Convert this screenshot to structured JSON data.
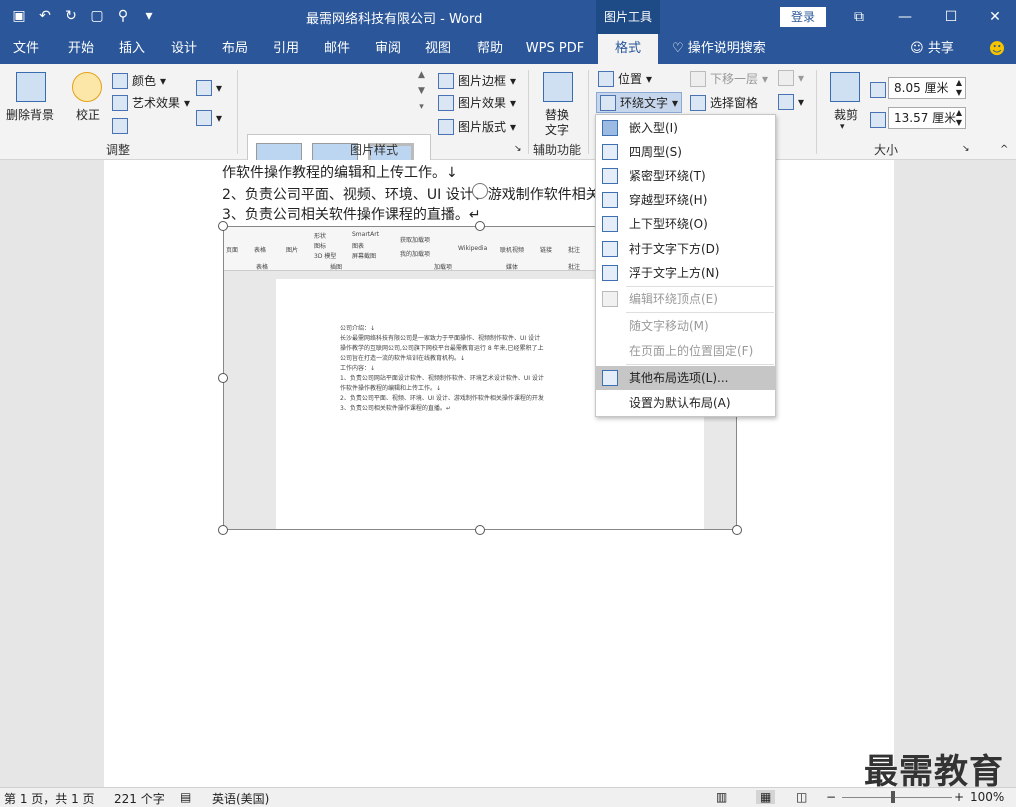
{
  "window": {
    "title": "最需网络科技有限公司  -  Word",
    "context_tab_group": "图片工具",
    "login_label": "登录",
    "qat_icons": [
      "save-icon",
      "undo-icon",
      "redo-icon",
      "new-doc-icon",
      "touch-icon",
      "customize-icon"
    ]
  },
  "tabs": [
    "文件",
    "开始",
    "插入",
    "设计",
    "布局",
    "引用",
    "邮件",
    "审阅",
    "视图",
    "帮助",
    "WPS PDF",
    "格式"
  ],
  "active_tab": "格式",
  "tell_me": "操作说明搜索",
  "share": "共享",
  "ribbon": {
    "adjust": {
      "remove_bg": "删除背景",
      "correct": "校正",
      "color": "颜色",
      "art_effect": "艺术效果",
      "group_label": "调整"
    },
    "picture_styles": {
      "border": "图片边框",
      "effect": "图片效果",
      "layout": "图片版式",
      "group_label": "图片样式"
    },
    "accessibility": {
      "alt_text_line1": "替换",
      "alt_text_line2": "文字",
      "group_label": "辅助功能"
    },
    "arrange": {
      "position": "位置",
      "wrap_text": "环绕文字",
      "send_backward": "下移一层",
      "selection_pane": "选择窗格"
    },
    "size": {
      "crop": "裁剪",
      "height": "8.05 厘米",
      "width": "13.57 厘米",
      "group_label": "大小"
    }
  },
  "document": {
    "line1": "作软件操作教程的编辑和上传工作。↓",
    "line2": "2、负责公司平面、视频、环境、UI 设计、游戏制作软件相关",
    "line3": "3、负责公司相关软件操作课程的直播。↵"
  },
  "picture": {
    "ribbon_labels": [
      "页面",
      "表格",
      "图片",
      "形状",
      "图标",
      "3D 模型",
      "SmartArt",
      "图表",
      "屏幕截图",
      "获取加载项",
      "我的加载项",
      "Wikipedia",
      "联机视频",
      "链接",
      "批注"
    ],
    "group_labels": [
      "表格",
      "插图",
      "加载项",
      "媒体",
      "批注"
    ],
    "lines": [
      "公司介绍：↓",
      "长沙最需网络科技有限公司是一家致力于平面操作、视频制作软件、UI 设计",
      "操作教学的互联网公司,公司旗下网校平台最需教育运行 8 年来,已经累积了上",
      "公司旨在打造一流的软件培训在线教育机构。↓",
      "工作内容：↓",
      "1、负责公司网站平面设计软件、视频制作软件、环境艺术设计软件、UI 设计",
      "作软件操作教程的编辑和上传工作。↓",
      "2、负责公司平面、视频、环境、UI 设计、游戏制作软件相关操作课程的开发",
      "3、负责公司相关软件操作课程的直播。↵"
    ]
  },
  "wrap_menu": {
    "items": [
      {
        "label": "嵌入型(I)",
        "icon": "inline-wrap-icon",
        "disabled": false
      },
      {
        "label": "四周型(S)",
        "icon": "square-wrap-icon",
        "disabled": false
      },
      {
        "label": "紧密型环绕(T)",
        "icon": "tight-wrap-icon",
        "disabled": false
      },
      {
        "label": "穿越型环绕(H)",
        "icon": "through-wrap-icon",
        "disabled": false
      },
      {
        "label": "上下型环绕(O)",
        "icon": "top-bottom-wrap-icon",
        "disabled": false
      },
      {
        "label": "衬于文字下方(D)",
        "icon": "behind-text-icon",
        "disabled": false
      },
      {
        "label": "浮于文字上方(N)",
        "icon": "in-front-text-icon",
        "disabled": false
      },
      {
        "label": "编辑环绕顶点(E)",
        "icon": "edit-wrap-points-icon",
        "disabled": true
      },
      {
        "label": "随文字移动(M)",
        "icon": "",
        "disabled": true
      },
      {
        "label": "在页面上的位置固定(F)",
        "icon": "",
        "disabled": true
      },
      {
        "label": "其他布局选项(L)...",
        "icon": "more-layout-icon",
        "disabled": false
      },
      {
        "label": "设置为默认布局(A)",
        "icon": "",
        "disabled": false
      }
    ],
    "highlighted": "其他布局选项(L)..."
  },
  "status": {
    "page": "第 1 页，共 1 页",
    "words": "221 个字",
    "language": "英语(美国)",
    "zoom": "100%"
  },
  "watermark": "最需教育"
}
